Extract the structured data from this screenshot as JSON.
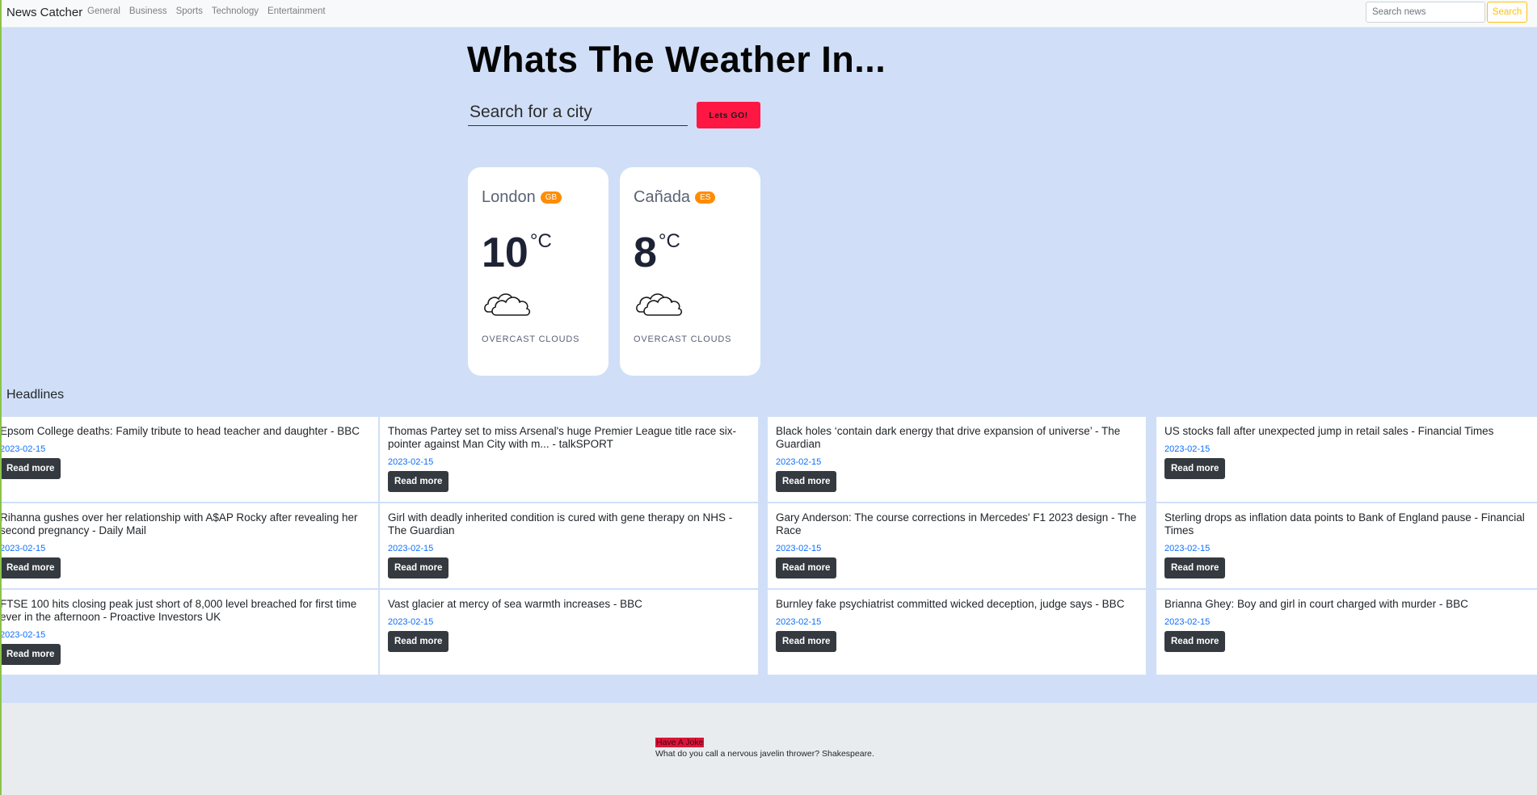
{
  "nav": {
    "brand": "News Catcher",
    "links": [
      "General",
      "Business",
      "Sports",
      "Technology",
      "Entertainment"
    ],
    "search_placeholder": "Search news",
    "search_button": "Search"
  },
  "weather": {
    "title": "Whats The Weather In...",
    "city_placeholder": "Search for a city",
    "go_button": "Lets GO!",
    "cards": [
      {
        "city": "London",
        "country": "GB",
        "temp": "10",
        "unit": "°C",
        "icon": "cloud-icon",
        "description": "OVERCAST CLOUDS"
      },
      {
        "city": "Cañada",
        "country": "ES",
        "temp": "8",
        "unit": "°C",
        "icon": "cloud-icon",
        "description": "OVERCAST CLOUDS"
      }
    ]
  },
  "headlines": {
    "label": "Headlines",
    "read_more": "Read more",
    "articles": [
      {
        "title": "Epsom College deaths: Family tribute to head teacher and daughter - BBC",
        "date": "2023-02-15"
      },
      {
        "title": "Thomas Partey set to miss Arsenal's huge Premier League title race six-pointer against Man City with m... - talkSPORT",
        "date": "2023-02-15"
      },
      {
        "title": "Black holes ‘contain dark energy that drive expansion of universe’ - The Guardian",
        "date": "2023-02-15"
      },
      {
        "title": "US stocks fall after unexpected jump in retail sales - Financial Times",
        "date": "2023-02-15"
      },
      {
        "title": "Rihanna gushes over her relationship with A$AP Rocky after revealing her second pregnancy - Daily Mail",
        "date": "2023-02-15"
      },
      {
        "title": "Girl with deadly inherited condition is cured with gene therapy on NHS - The Guardian",
        "date": "2023-02-15"
      },
      {
        "title": "Gary Anderson: The course corrections in Mercedes' F1 2023 design - The Race",
        "date": "2023-02-15"
      },
      {
        "title": "Sterling drops as inflation data points to Bank of England pause - Financial Times",
        "date": "2023-02-15"
      },
      {
        "title": "FTSE 100 hits closing peak just short of 8,000 level breached for first time ever in the afternoon - Proactive Investors UK",
        "date": "2023-02-15"
      },
      {
        "title": "Vast glacier at mercy of sea warmth increases - BBC",
        "date": "2023-02-15"
      },
      {
        "title": "Burnley fake psychiatrist committed wicked deception, judge says - BBC",
        "date": "2023-02-15"
      },
      {
        "title": "Brianna Ghey: Boy and girl in court charged with murder - BBC",
        "date": "2023-02-15"
      }
    ]
  },
  "joke": {
    "label": "Have A Joke",
    "text": "What do you call a nervous javelin thrower? Shakespeare."
  },
  "colors": {
    "panel_bg": "#d0dff7",
    "go_button": "#ff1744",
    "badge": "#ff8c00",
    "date": "#0d6efd",
    "read_button": "#343a40"
  }
}
